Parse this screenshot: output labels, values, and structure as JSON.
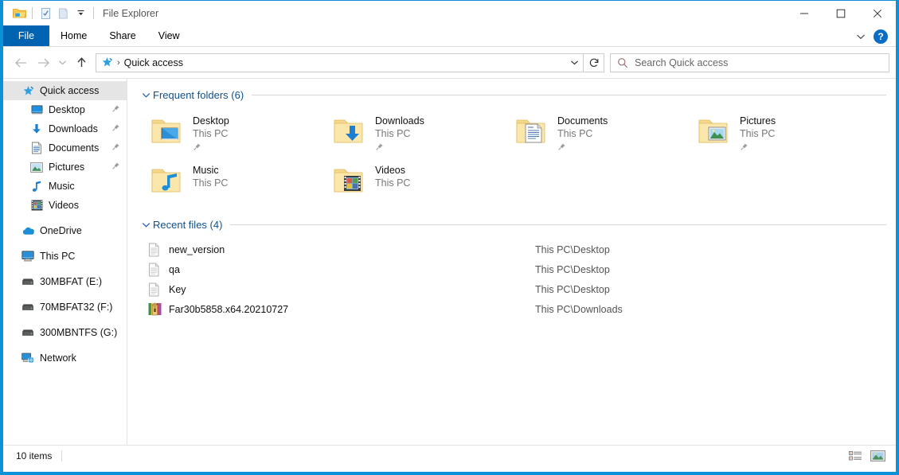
{
  "window": {
    "title": "File Explorer",
    "quick_access_toolbar": [
      {
        "name": "explorer-app-icon",
        "label": "File Explorer"
      },
      {
        "name": "properties-icon",
        "label": "Properties"
      },
      {
        "name": "new-folder-icon",
        "label": "New folder"
      },
      {
        "name": "customize-qat-chevron-icon",
        "label": "Customize Quick Access Toolbar"
      }
    ],
    "controls": {
      "minimize": "—",
      "maximize": "□",
      "close": "✕"
    }
  },
  "ribbon": {
    "tabs": [
      {
        "label": "File",
        "active": true
      },
      {
        "label": "Home",
        "active": false
      },
      {
        "label": "Share",
        "active": false
      },
      {
        "label": "View",
        "active": false
      }
    ],
    "collapse_label": "∨",
    "help_label": "?"
  },
  "navigation": {
    "back_label": "←",
    "forward_label": "→",
    "recent_label": "∨",
    "up_label": "↑",
    "breadcrumb": {
      "icon": "quick-access-star-icon",
      "separator": "›",
      "text": "Quick access"
    },
    "address_dropdown": "∨",
    "refresh_label": "↻"
  },
  "search": {
    "placeholder": "Search Quick access",
    "value": ""
  },
  "sidebar": {
    "items": [
      {
        "label": "Quick access",
        "icon": "quick-access-star-icon",
        "selected": true,
        "child": false,
        "pinned": false
      },
      {
        "label": "Desktop",
        "icon": "desktop-icon",
        "selected": false,
        "child": true,
        "pinned": true
      },
      {
        "label": "Downloads",
        "icon": "downloads-arrow-icon",
        "selected": false,
        "child": true,
        "pinned": true
      },
      {
        "label": "Documents",
        "icon": "documents-icon",
        "selected": false,
        "child": true,
        "pinned": true
      },
      {
        "label": "Pictures",
        "icon": "pictures-icon",
        "selected": false,
        "child": true,
        "pinned": true
      },
      {
        "label": "Music",
        "icon": "music-note-icon",
        "selected": false,
        "child": true,
        "pinned": false
      },
      {
        "label": "Videos",
        "icon": "videos-filmstrip-icon",
        "selected": false,
        "child": true,
        "pinned": false
      },
      {
        "label": "OneDrive",
        "icon": "onedrive-cloud-icon",
        "selected": false,
        "child": false,
        "pinned": false,
        "gap_before": true
      },
      {
        "label": "This PC",
        "icon": "this-pc-monitor-icon",
        "selected": false,
        "child": false,
        "pinned": false,
        "gap_before": true
      },
      {
        "label": "30MBFAT (E:)",
        "icon": "drive-icon",
        "selected": false,
        "child": false,
        "pinned": false,
        "gap_before": true
      },
      {
        "label": "70MBFAT32 (F:)",
        "icon": "drive-icon",
        "selected": false,
        "child": false,
        "pinned": false,
        "gap_before": true
      },
      {
        "label": "300MBNTFS (G:)",
        "icon": "drive-icon",
        "selected": false,
        "child": false,
        "pinned": false,
        "gap_before": true
      },
      {
        "label": "Network",
        "icon": "network-icon",
        "selected": false,
        "child": false,
        "pinned": false,
        "gap_before": true
      }
    ]
  },
  "main": {
    "frequent_folders": {
      "chevron": "∨",
      "title": "Frequent folders (6)",
      "items": [
        {
          "name": "Desktop",
          "sub": "This PC",
          "icon": "folder-desktop-icon",
          "pinned": true
        },
        {
          "name": "Downloads",
          "sub": "This PC",
          "icon": "folder-downloads-icon",
          "pinned": true
        },
        {
          "name": "Documents",
          "sub": "This PC",
          "icon": "folder-documents-icon",
          "pinned": true
        },
        {
          "name": "Pictures",
          "sub": "This PC",
          "icon": "folder-pictures-icon",
          "pinned": true
        },
        {
          "name": "Music",
          "sub": "This PC",
          "icon": "folder-music-icon",
          "pinned": false
        },
        {
          "name": "Videos",
          "sub": "This PC",
          "icon": "folder-videos-icon",
          "pinned": false
        }
      ]
    },
    "recent_files": {
      "chevron": "∨",
      "title": "Recent files (4)",
      "items": [
        {
          "name": "new_version",
          "path": "This PC\\Desktop",
          "icon": "generic-file-icon"
        },
        {
          "name": "qa",
          "path": "This PC\\Desktop",
          "icon": "generic-file-icon"
        },
        {
          "name": "Key",
          "path": "This PC\\Desktop",
          "icon": "generic-file-icon"
        },
        {
          "name": "Far30b5858.x64.20210727",
          "path": "This PC\\Downloads",
          "icon": "archive-file-icon"
        }
      ]
    }
  },
  "statusbar": {
    "item_count": "10 items",
    "views": [
      {
        "name": "details-view-button",
        "label": "Details view"
      },
      {
        "name": "large-icons-view-button",
        "label": "Large icons view"
      }
    ]
  },
  "colors": {
    "window_border": "#0a91d8",
    "file_tab": "#0063b1",
    "group_heading": "#10508c",
    "selection": "#e5e5e5"
  }
}
